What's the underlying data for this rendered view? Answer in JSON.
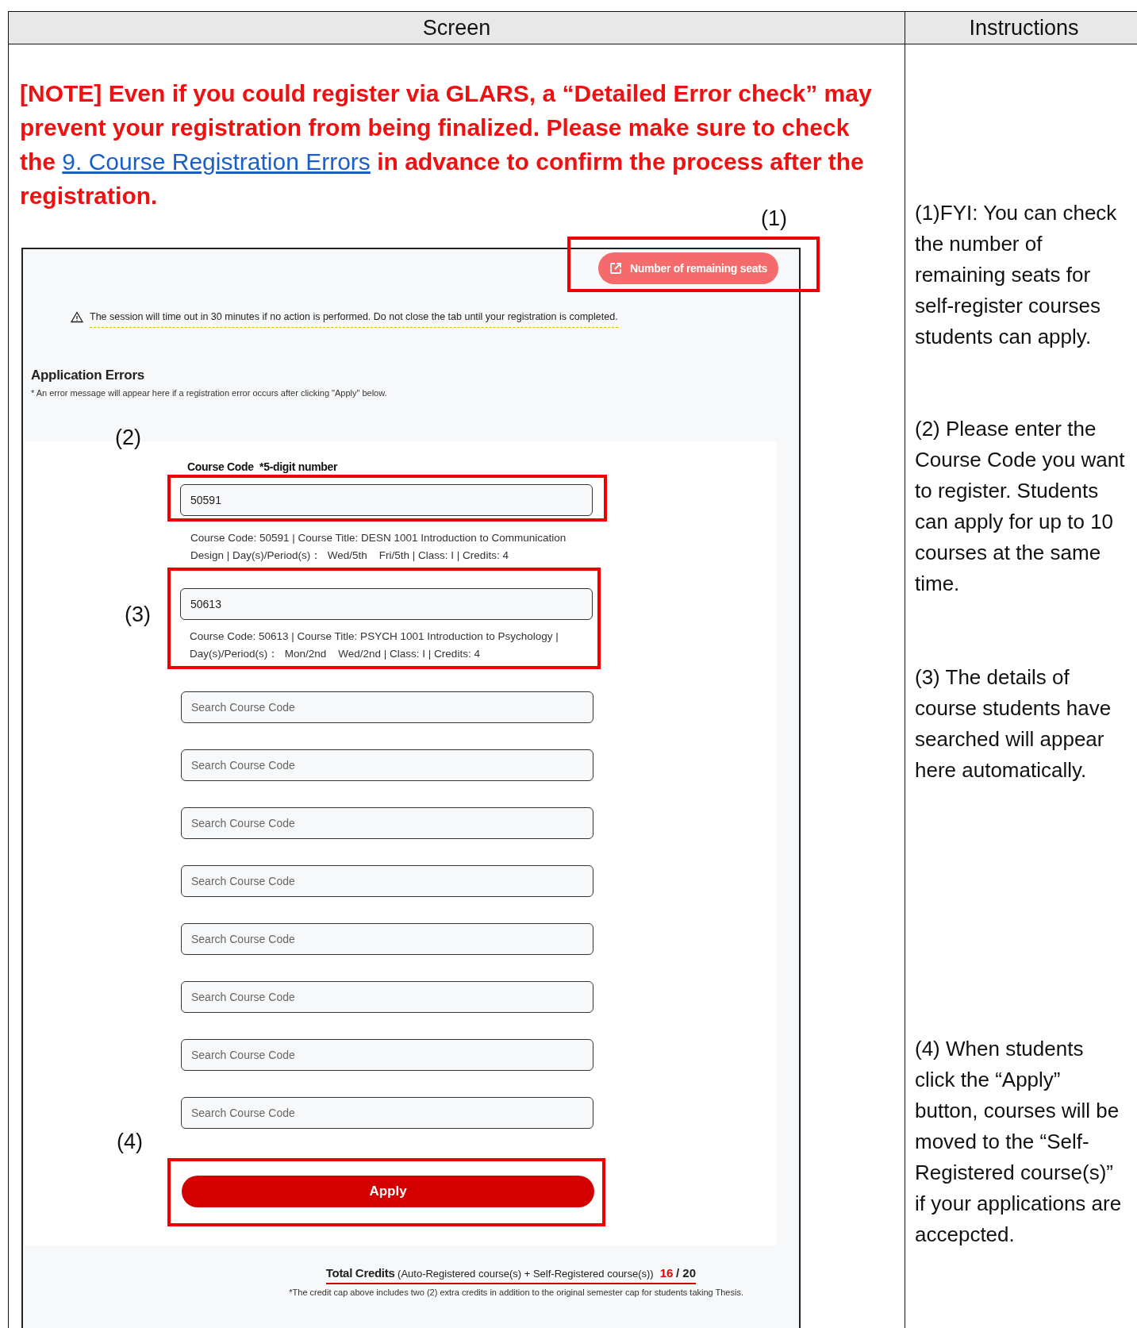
{
  "table": {
    "columns": [
      "Screen",
      "Instructions"
    ]
  },
  "note": {
    "before": "[NOTE] Even if you could register via GLARS, a “Detailed Error check” may prevent your registration from being finalized. Please make sure to check the ",
    "link": "9. Course Registration Errors",
    "after": " in advance to confirm the process after the registration."
  },
  "markers": [
    "(1)",
    "(2)",
    "(3)",
    "(4)"
  ],
  "screen": {
    "remaining_seats_button": "Number of remaining seats",
    "timeout_warning": "The session will time out in 30 minutes if no action is performed. Do not close the tab until your registration is completed.",
    "errors": {
      "title": "Application Errors",
      "hint": "* An error message will appear here if a registration error occurs after clicking \"Apply\" below."
    },
    "course_code_label": "Course Code  *5-digit number",
    "course_fields": [
      {
        "value": "50591",
        "details": "Course Code: 50591 | Course Title: DESN 1001 Introduction to Communication Design | Day(s)/Period(s)：  Wed/5th    Fri/5th | Class: I | Credits: 4"
      },
      {
        "value": "50613",
        "details": "Course Code: 50613 | Course Title: PSYCH 1001 Introduction to Psychology | Day(s)/Period(s)：  Mon/2nd    Wed/2nd | Class: I | Credits: 4"
      },
      {
        "placeholder": "Search Course Code"
      },
      {
        "placeholder": "Search Course Code"
      },
      {
        "placeholder": "Search Course Code"
      },
      {
        "placeholder": "Search Course Code"
      },
      {
        "placeholder": "Search Course Code"
      },
      {
        "placeholder": "Search Course Code"
      },
      {
        "placeholder": "Search Course Code"
      },
      {
        "placeholder": "Search Course Code"
      }
    ],
    "apply_button": "Apply",
    "total_credits": {
      "label": "Total Credits",
      "formula": "(Auto-Registered course(s) + Self-Registered course(s))",
      "current": "16",
      "cap": "/ 20"
    },
    "footnote": "*The credit cap above includes two (2) extra credits in addition to the original semester cap for students taking Thesis."
  },
  "instructions": [
    "(1)FYI: You can check the number of remaining seats for self-register courses students can apply.",
    "(2) Please enter the Course Code you want to register. Students can apply for up to 10 courses at the same time.",
    "(3) The details of course students have searched will appear here automatically.",
    "(4) When students click the “Apply” button, courses will be moved to the “Self-Registered course(s)” if your applications are accepcted."
  ]
}
